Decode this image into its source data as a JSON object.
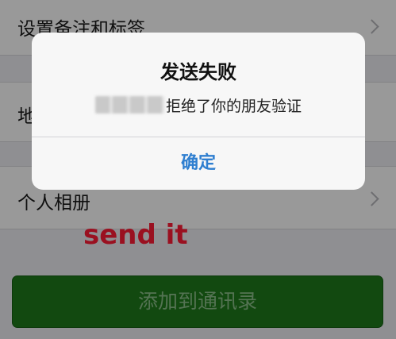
{
  "background_list": {
    "row_remark_tags": {
      "label": "设置备注和标签"
    },
    "row_region": {
      "label": "地"
    },
    "row_album": {
      "label": "个人相册"
    }
  },
  "annotation": {
    "text": "send it"
  },
  "add_button": {
    "label": "添加到通讯录"
  },
  "alert": {
    "title": "发送失败",
    "message_suffix": "拒绝了你的朋友验证",
    "confirm_label": "确定"
  },
  "colors": {
    "add_button_bg": "#1f7a1c",
    "alert_button_text": "#2f7fd0",
    "annotation_text": "#9a1020"
  },
  "icons": [
    "chevron-right-icon"
  ]
}
